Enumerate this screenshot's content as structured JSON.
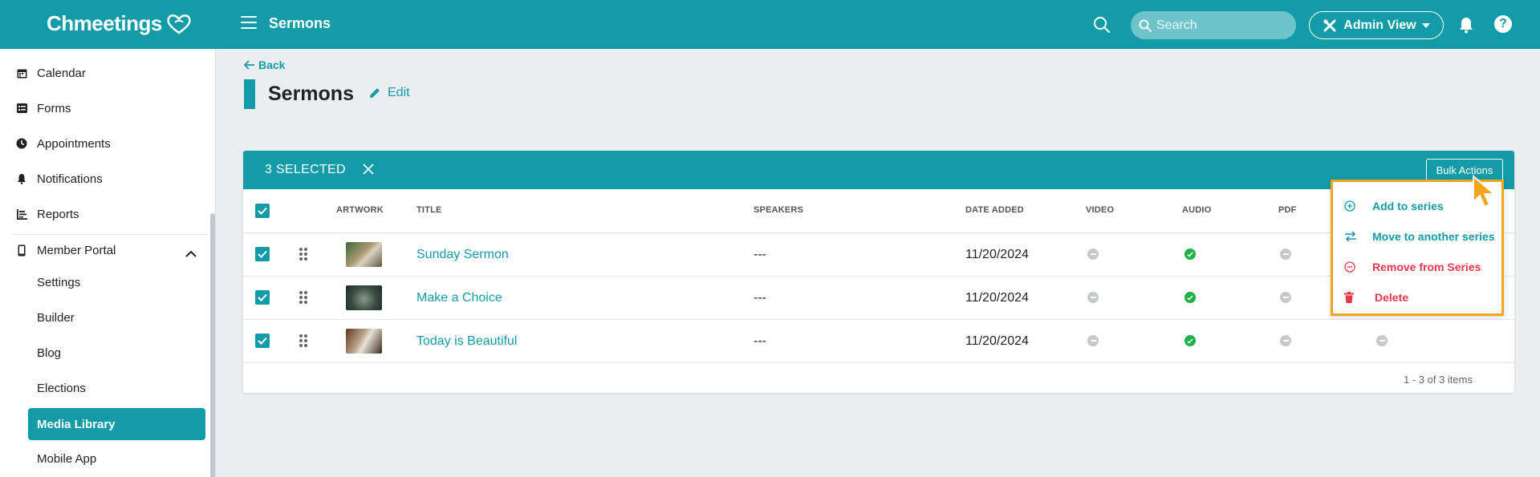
{
  "header": {
    "logo": "Chmeetings",
    "title": "Sermons",
    "search_placeholder": "Search",
    "admin_view_label": "Admin View"
  },
  "sidebar": {
    "items": [
      {
        "label": "Calendar",
        "icon": "calendar-icon"
      },
      {
        "label": "Forms",
        "icon": "forms-icon"
      },
      {
        "label": "Appointments",
        "icon": "clock-icon"
      },
      {
        "label": "Notifications",
        "icon": "bell-icon"
      },
      {
        "label": "Reports",
        "icon": "reports-icon"
      },
      {
        "label": "Member Portal",
        "icon": "phone-icon"
      }
    ],
    "sub_items": [
      {
        "label": "Settings"
      },
      {
        "label": "Builder"
      },
      {
        "label": "Blog"
      },
      {
        "label": "Elections"
      },
      {
        "label": "Media Library",
        "active": true
      },
      {
        "label": "Mobile App"
      }
    ]
  },
  "page": {
    "back_label": "Back",
    "title": "Sermons",
    "edit_label": "Edit"
  },
  "table": {
    "selected_label": "3 SELECTED",
    "bulk_actions_label": "Bulk Actions",
    "columns": [
      "ARTWORK",
      "TITLE",
      "SPEAKERS",
      "DATE ADDED",
      "VIDEO",
      "AUDIO",
      "PDF"
    ],
    "rows": [
      {
        "title": "Sunday Sermon",
        "speakers": "---",
        "date_added": "11/20/2024",
        "video": false,
        "audio": true,
        "pdf": false,
        "checked": true
      },
      {
        "title": "Make a Choice",
        "speakers": "---",
        "date_added": "11/20/2024",
        "video": false,
        "audio": true,
        "pdf": false,
        "checked": true
      },
      {
        "title": "Today is Beautiful",
        "speakers": "---",
        "date_added": "11/20/2024",
        "video": false,
        "audio": true,
        "pdf": false,
        "checked": true
      }
    ],
    "pager": "1 - 3 of 3 items"
  },
  "bulk_menu": {
    "items": [
      {
        "label": "Add to series",
        "icon": "plus-circle-icon",
        "color": "#149ba8"
      },
      {
        "label": "Move to another series",
        "icon": "swap-arrows-icon",
        "color": "#149ba8"
      },
      {
        "label": "Remove from Series",
        "icon": "minus-circle-icon",
        "color": "#e8374c"
      },
      {
        "label": "Delete",
        "icon": "trash-icon",
        "color": "#e8374c"
      }
    ]
  },
  "colors": {
    "brand": "#149ba8",
    "danger": "#e8374c",
    "success": "#1fb14a",
    "highlight": "#f2a51a"
  }
}
